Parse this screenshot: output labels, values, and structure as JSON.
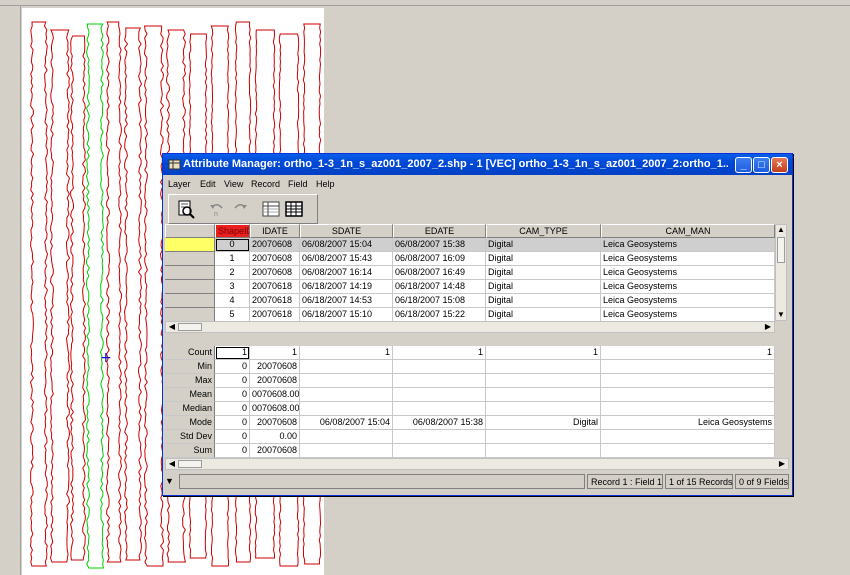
{
  "window": {
    "title": "Attribute Manager: ortho_1-3_1n_s_az001_2007_2.shp - 1 [VEC] ortho_1-3_1n_s_az001_2007_2:ortho_1...",
    "buttons": {
      "minimize": "_",
      "maximize": "□",
      "close": "×"
    }
  },
  "menu": [
    "Layer",
    "Edit",
    "View",
    "Record",
    "Field",
    "Help"
  ],
  "toolbar": [
    "query-icon",
    "undo-icon",
    "redo-icon",
    "single-record-view-icon",
    "table-view-icon"
  ],
  "columns": [
    "ShapeID",
    "IDATE",
    "SDATE",
    "EDATE",
    "CAM_TYPE",
    "CAM_MAN"
  ],
  "rows": [
    [
      "0",
      "20070608",
      "06/08/2007 15:04",
      "06/08/2007 15:38",
      "Digital",
      "Leica Geosystems"
    ],
    [
      "1",
      "20070608",
      "06/08/2007 15:43",
      "06/08/2007 16:09",
      "Digital",
      "Leica Geosystems"
    ],
    [
      "2",
      "20070608",
      "06/08/2007 16:14",
      "06/08/2007 16:49",
      "Digital",
      "Leica Geosystems"
    ],
    [
      "3",
      "20070618",
      "06/18/2007 14:19",
      "06/18/2007 14:48",
      "Digital",
      "Leica Geosystems"
    ],
    [
      "4",
      "20070618",
      "06/18/2007 14:53",
      "06/18/2007 15:08",
      "Digital",
      "Leica Geosystems"
    ],
    [
      "5",
      "20070618",
      "06/18/2007 15:10",
      "06/18/2007 15:22",
      "Digital",
      "Leica Geosystems"
    ]
  ],
  "stats": [
    {
      "label": "Count",
      "values": [
        "1",
        "1",
        "1",
        "1",
        "1",
        "1"
      ]
    },
    {
      "label": "Min",
      "values": [
        "0",
        "20070608",
        "",
        "",
        "",
        ""
      ]
    },
    {
      "label": "Max",
      "values": [
        "0",
        "20070608",
        "",
        "",
        "",
        ""
      ]
    },
    {
      "label": "Mean",
      "values": [
        "0",
        "0070608.00",
        "",
        "",
        "",
        ""
      ]
    },
    {
      "label": "Median",
      "values": [
        "0",
        "0070608.00",
        "",
        "",
        "",
        ""
      ]
    },
    {
      "label": "Mode",
      "values": [
        "0",
        "20070608",
        "06/08/2007 15:04",
        "06/08/2007 15:38",
        "Digital",
        "Leica Geosystems"
      ]
    },
    {
      "label": "Std Dev",
      "values": [
        "0",
        "0.00",
        "",
        "",
        "",
        ""
      ]
    },
    {
      "label": "Sum",
      "values": [
        "0",
        "20070608",
        "",
        "",
        "",
        ""
      ]
    }
  ],
  "status": {
    "arrow": "▼",
    "position": "Record 1 : Field 1",
    "records": "1 of 15 Records",
    "fields": "0 of 9 Fields"
  },
  "colors": {
    "title_bar": "#0049d6",
    "selected_header": "#e82020",
    "current_row_marker": "#ffff66",
    "red_polygons": "#cc0000",
    "green_polygon": "#00cc00"
  },
  "map": {
    "cursor": "+"
  }
}
